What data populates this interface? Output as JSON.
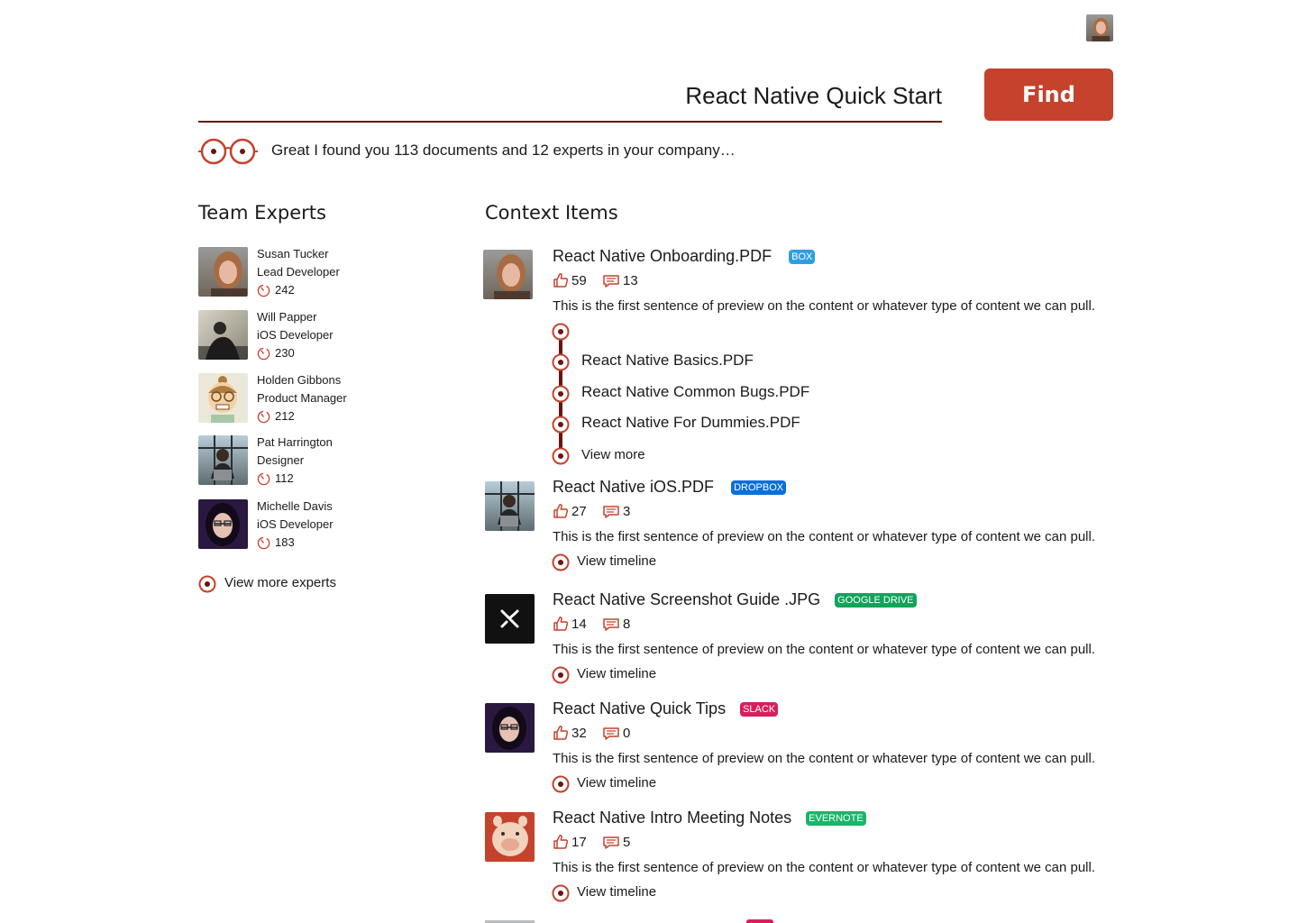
{
  "search": {
    "query": "React Native Quick Start",
    "find_label": "Find"
  },
  "summary": "Great I found you 113 documents and 12 experts in your company…",
  "experts_section": {
    "title": "Team Experts",
    "experts": [
      {
        "name": "Susan Tucker",
        "role": "Lead Developer",
        "count": "242"
      },
      {
        "name": "Will Papper",
        "role": "iOS Developer",
        "count": "230"
      },
      {
        "name": "Holden Gibbons",
        "role": "Product Manager",
        "count": "212"
      },
      {
        "name": "Pat Harrington",
        "role": "Designer",
        "count": "112"
      },
      {
        "name": "Michelle Davis",
        "role": "iOS Developer",
        "count": "183"
      }
    ],
    "view_more": "View more experts"
  },
  "context_section": {
    "title": "Context Items",
    "items": [
      {
        "title": "React Native Onboarding.PDF",
        "source": "BOX",
        "source_color": "#2d9fe0",
        "likes": "59",
        "comments": "13",
        "preview": "This is the first sentence of preview on the content or whatever type of content we can pull.",
        "timeline": [
          "React Native Basics.PDF",
          "React Native Common Bugs.PDF",
          "React Native For Dummies.PDF"
        ],
        "view_more": "View more"
      },
      {
        "title": "React Native iOS.PDF",
        "source": "DROPBOX",
        "source_color": "#0b6fdb",
        "likes": "27",
        "comments": "3",
        "preview": "This is the first sentence of preview on the content or whatever type of content we can pull.",
        "link": "View timeline"
      },
      {
        "title": "React Native Screenshot Guide .JPG",
        "source": "GOOGLE DRIVE",
        "source_color": "#12a35b",
        "likes": "14",
        "comments": "8",
        "preview": "This is the first sentence of preview on the content or whatever type of content we can pull.",
        "link": "View timeline"
      },
      {
        "title": "React Native Quick Tips",
        "source": "SLACK",
        "source_color": "#d81e5b",
        "likes": "32",
        "comments": "0",
        "preview": "This is the first sentence of preview on the content or whatever type of content we can pull.",
        "link": "View timeline"
      },
      {
        "title": "React Native Intro Meeting Notes",
        "source": "EVERNOTE",
        "source_color": "#1bb56a",
        "likes": "17",
        "comments": "5",
        "preview": "This is the first sentence of preview on the content or whatever type of content we can pull.",
        "link": "View timeline"
      }
    ]
  },
  "colors": {
    "accent": "#c5422c",
    "dark_red": "#6b1410"
  },
  "icons": [
    "avatar",
    "glasses-icon",
    "clock-icon",
    "thumbs-up-icon",
    "comment-icon",
    "timeline-dot-icon"
  ]
}
